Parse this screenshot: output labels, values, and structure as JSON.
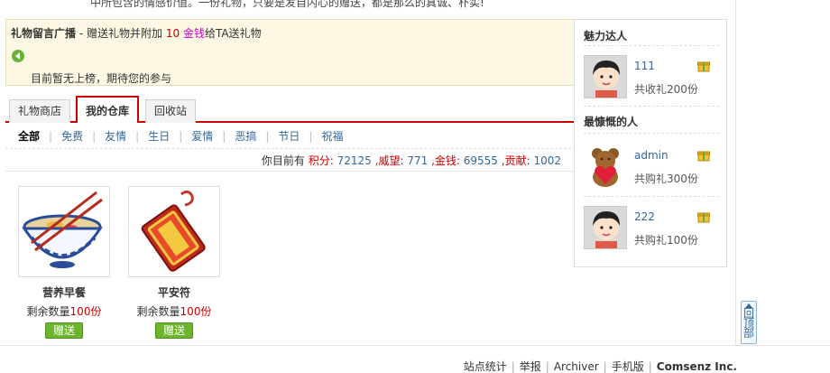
{
  "intro_text": "中所包含的情感价值。一份礼物，只要是发自内心的赠送，都是那么的真诚、朴实!",
  "broadcast": {
    "title": "礼物留言广播",
    "desc_pre": "- 赠送礼物并附加",
    "amount": "10",
    "currency": "金钱",
    "desc_post": "给TA送礼物",
    "empty_text": "目前暂无上榜，期待您的参与"
  },
  "tabs": [
    "礼物商店",
    "我的仓库",
    "回收站"
  ],
  "active_tab": "我的仓库",
  "categories": [
    "全部",
    "免费",
    "友情",
    "生日",
    "爱情",
    "恶搞",
    "节日",
    "祝福"
  ],
  "stats": {
    "prefix": "你目前有",
    "points_label": "积分:",
    "points": "72125",
    "prestige_label": ",威望:",
    "prestige": "771",
    "money_label": ",金钱:",
    "money": "69555",
    "contrib_label": ",贡献:",
    "contrib": "1002"
  },
  "gifts": [
    {
      "name": "营养早餐",
      "remain_label": "剩余数量",
      "remain": "100份",
      "button": "赠送"
    },
    {
      "name": "平安符",
      "remain_label": "剩余数量",
      "remain": "100份",
      "button": "赠送"
    }
  ],
  "charm_talent": {
    "title": "魅力达人",
    "people": [
      {
        "name": "111",
        "desc": "共收礼200份"
      }
    ]
  },
  "generous": {
    "title": "最慷慨的人",
    "people": [
      {
        "name": "admin",
        "desc": "共购礼300份"
      },
      {
        "name": "222",
        "desc": "共购礼100份"
      }
    ]
  },
  "back_to_top": "回顶部",
  "footer": {
    "links": [
      "站点统计",
      "举报",
      "Archiver",
      "手机版"
    ],
    "brand": "Comsenz Inc."
  },
  "colors": {
    "accent_red": "#cc0000",
    "link_blue": "#336699",
    "button_green": "#6cb52c",
    "broadcast_bg": "#fdf8e4"
  }
}
